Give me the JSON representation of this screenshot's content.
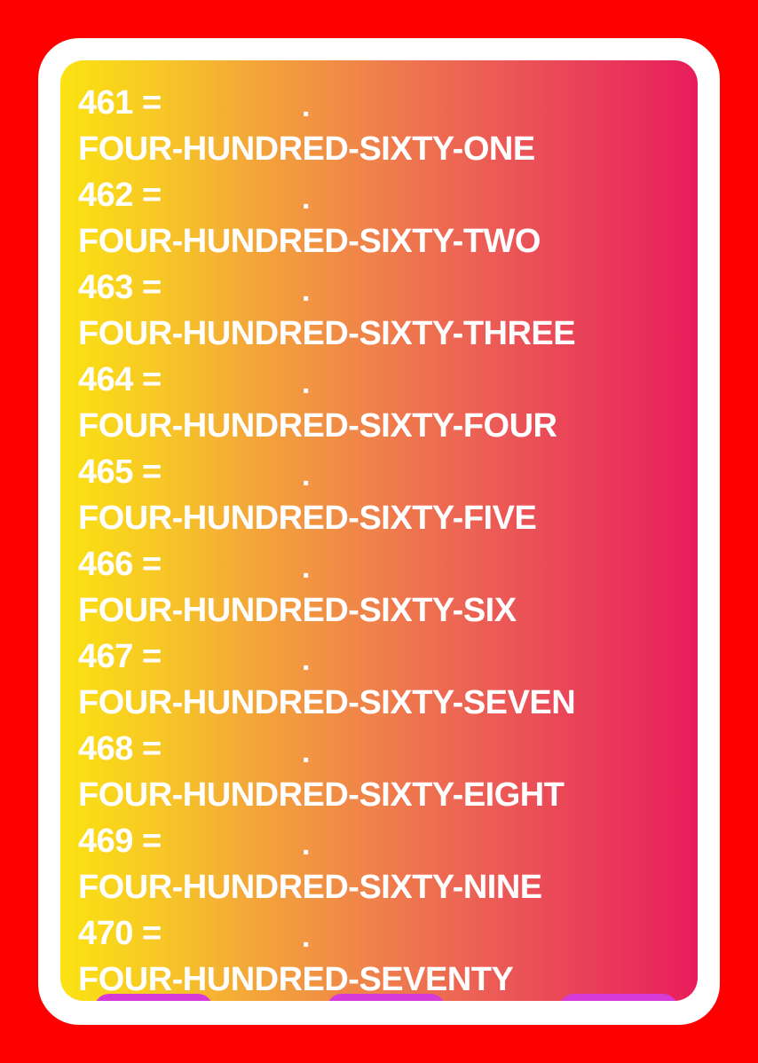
{
  "colors": {
    "page_background": "#ff0000",
    "frame": "#ffffff",
    "gradient_start": "#fbe312",
    "gradient_end": "#e81d5b",
    "text": "#ffffff",
    "pill": "#d63bd8"
  },
  "entries": [
    {
      "number": "461 =",
      "dot": ".",
      "words": "FOUR-HUNDRED-SIXTY-ONE"
    },
    {
      "number": "462 =",
      "dot": ".",
      "words": "FOUR-HUNDRED-SIXTY-TWO"
    },
    {
      "number": "463 =",
      "dot": ".",
      "words": "FOUR-HUNDRED-SIXTY-THREE"
    },
    {
      "number": "464 =",
      "dot": ".",
      "words": "FOUR-HUNDRED-SIXTY-FOUR"
    },
    {
      "number": "465 =",
      "dot": ".",
      "words": "FOUR-HUNDRED-SIXTY-FIVE"
    },
    {
      "number": "466 =",
      "dot": ".",
      "words": "FOUR-HUNDRED-SIXTY-SIX"
    },
    {
      "number": "467 =",
      "dot": ".",
      "words": "FOUR-HUNDRED-SIXTY-SEVEN"
    },
    {
      "number": "468 =",
      "dot": ".",
      "words": "FOUR-HUNDRED-SIXTY-EIGHT"
    },
    {
      "number": "469 =",
      "dot": ".",
      "words": "FOUR-HUNDRED-SIXTY-NINE"
    },
    {
      "number": "470 =",
      "dot": ".",
      "words": "FOUR-HUNDRED-SEVENTY"
    }
  ]
}
